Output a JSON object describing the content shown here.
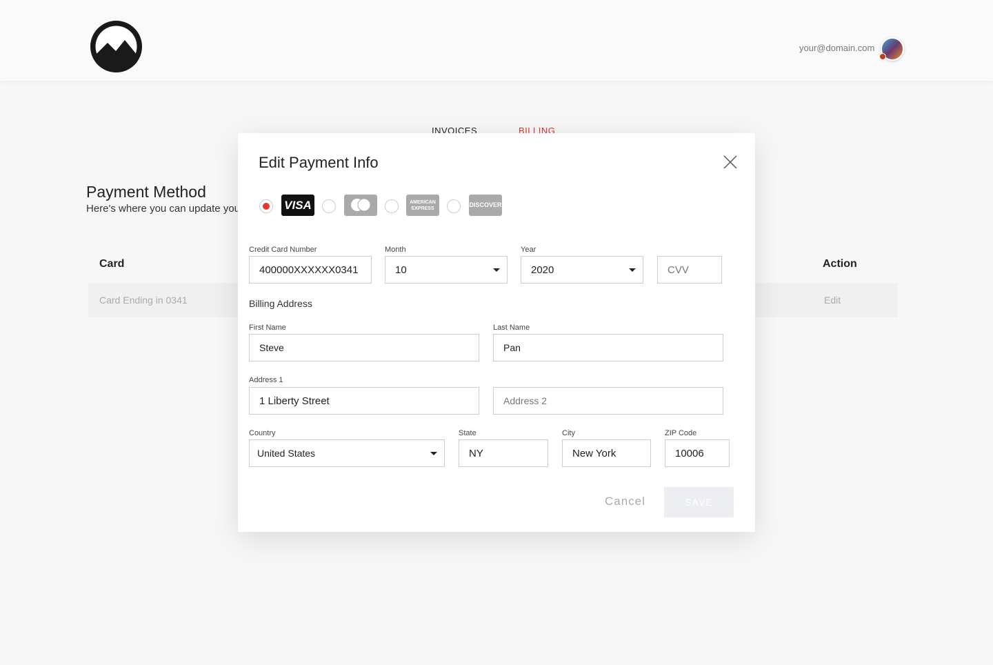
{
  "header": {
    "email": "your@domain.com"
  },
  "tabs": [
    {
      "label": "INVOICES"
    },
    {
      "label": "BILLING",
      "color": "#d9382b"
    }
  ],
  "page": {
    "title": "Payment Method",
    "subtitle": "Here's where you can update your payment method"
  },
  "table": {
    "headers": [
      "Card",
      "Action"
    ],
    "rows": [
      {
        "card": "Card Ending in 0341",
        "action": "Edit"
      }
    ]
  },
  "modal": {
    "title": "Edit Payment Info",
    "card_types": [
      {
        "name": "VISA",
        "selected": true
      },
      {
        "name": "mastercard",
        "selected": false
      },
      {
        "name": "AMERICAN EXPRESS",
        "selected": false
      },
      {
        "name": "DISCOVER",
        "selected": false
      }
    ],
    "fields": {
      "card_number": {
        "label": "Credit Card Number",
        "value": "400000XXXXXX0341"
      },
      "month": {
        "label": "Month",
        "value": "10"
      },
      "year": {
        "label": "Year",
        "value": "2020"
      },
      "cvv": {
        "placeholder": "CVV"
      },
      "billing_title": "Billing Address",
      "first_name": {
        "label": "First Name",
        "value": "Steve"
      },
      "last_name": {
        "label": "Last Name",
        "value": "Pan"
      },
      "address1": {
        "label": "Address 1",
        "value": "1 Liberty Street"
      },
      "address2": {
        "placeholder": "Address 2"
      },
      "country": {
        "label": "Country",
        "value": "United States"
      },
      "state": {
        "label": "State",
        "value": "NY"
      },
      "city": {
        "label": "City",
        "value": "New York"
      },
      "zip": {
        "label": "ZIP Code",
        "value": "10006"
      }
    },
    "cancel_label": "Cancel",
    "save_label": "SAVE"
  },
  "colors": {
    "accent": "#e53a2a"
  }
}
